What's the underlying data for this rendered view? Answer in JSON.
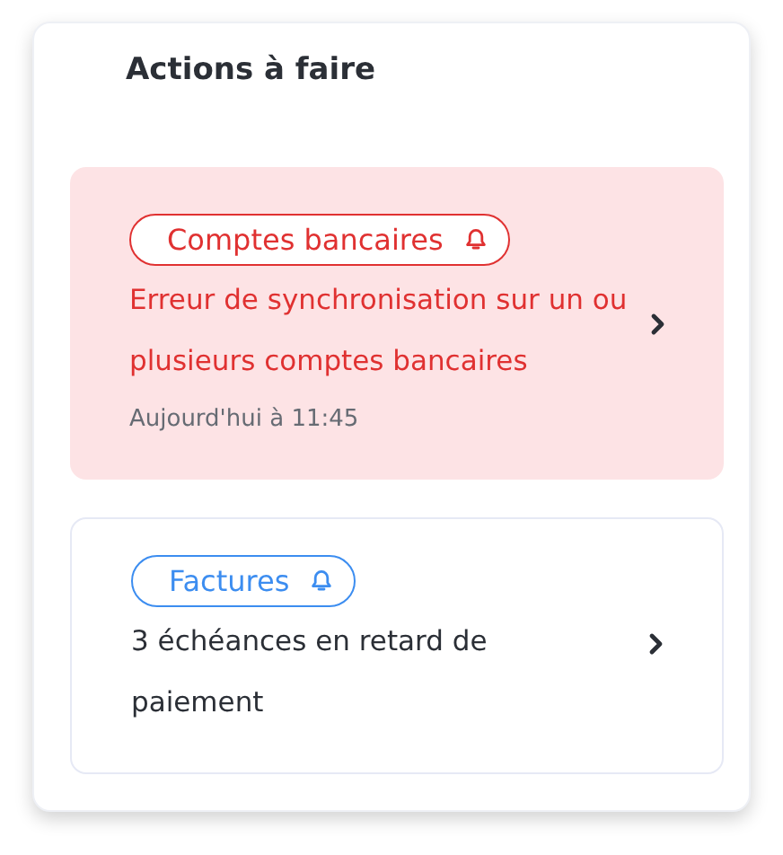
{
  "panel": {
    "title": "Actions à faire"
  },
  "items": [
    {
      "kind": "error",
      "tag": "Comptes bancaires",
      "message": "Erreur de synchronisation sur un ou plusieurs comptes bancaires",
      "time": "Aujourd'hui à 11:45"
    },
    {
      "kind": "info",
      "tag": "Factures",
      "message": "3 échéances en retard de paiement"
    }
  ]
}
